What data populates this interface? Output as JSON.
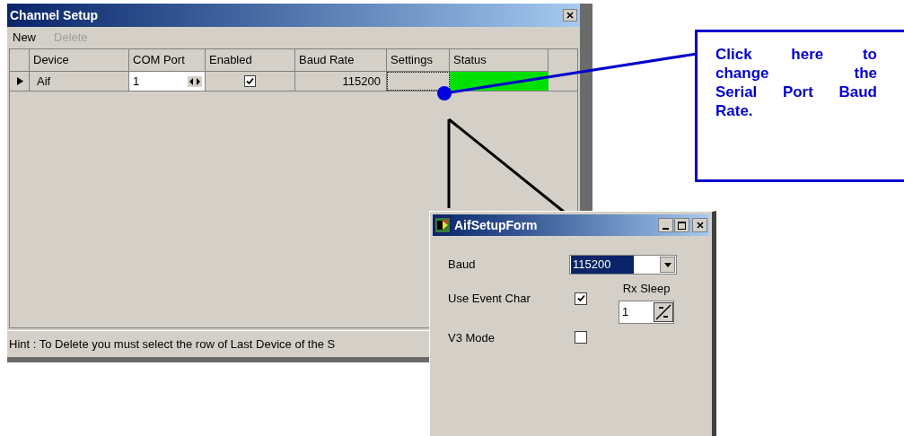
{
  "channel_setup": {
    "title": "Channel Setup",
    "menu": [
      {
        "label": "New",
        "disabled": false
      },
      {
        "label": "Delete",
        "disabled": true
      }
    ],
    "table": {
      "columns": [
        "Device",
        "COM Port",
        "Enabled",
        "Baud Rate",
        "Settings",
        "Status"
      ],
      "rows": [
        {
          "selected": true,
          "device": "Aif",
          "com_port": "1",
          "enabled": true,
          "baud_rate": "115200"
        }
      ]
    },
    "hint": "Hint : To Delete you must select the row of Last Device of the S"
  },
  "callout": {
    "text": "Click here to change the Serial Port Baud Rate."
  },
  "aif_setup_form": {
    "title": "AifSetupForm",
    "baud": {
      "label": "Baud",
      "value": "115200"
    },
    "options": [
      {
        "label": "Use Event Char",
        "checked": true
      },
      {
        "label": "V3 Mode",
        "checked": false
      }
    ],
    "rx_sleep": {
      "label": "Rx Sleep",
      "value": "1"
    }
  }
}
